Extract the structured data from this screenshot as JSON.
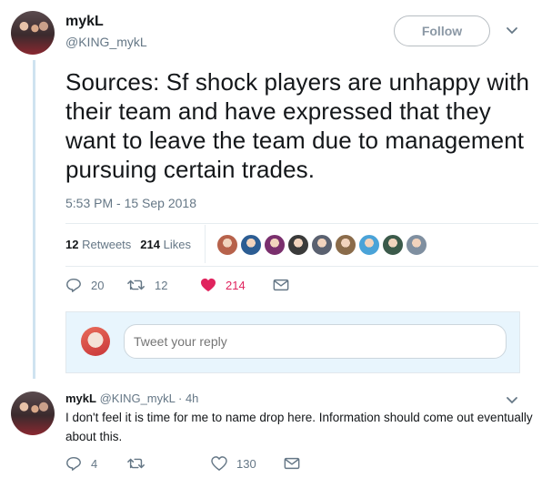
{
  "tweet": {
    "author_name": "mykL",
    "author_handle": "@KING_mykL",
    "follow_label": "Follow",
    "text": "Sources: Sf shock players are unhappy with their team and have expressed that they want to leave the team due to management pursuing certain trades.",
    "timestamp": "5:53 PM - 15 Sep 2018",
    "retweets_count": "12",
    "retweets_label": "Retweets",
    "likes_count": "214",
    "likes_label": "Likes",
    "likers": [
      "#b7624b",
      "#2c5d93",
      "#7a2f6d",
      "#3a3a3a",
      "#5a6170",
      "#8a6b4a",
      "#4aa3d8",
      "#3b5a4a",
      "#7f8fa0"
    ],
    "reply_count": "20",
    "retweet_count_short": "12",
    "like_count_short": "214"
  },
  "reply_box": {
    "placeholder": "Tweet your reply"
  },
  "reply": {
    "author_name": "mykL",
    "author_handle": "@KING_mykL",
    "time": "· 4h",
    "text": "I don't feel it is time for me to name drop here. Information should come out eventually about this.",
    "reply_count": "4",
    "like_count": "130"
  },
  "colors": {
    "like": "#e0245e",
    "muted": "#657786",
    "thread_line": "#cfe3f0"
  }
}
